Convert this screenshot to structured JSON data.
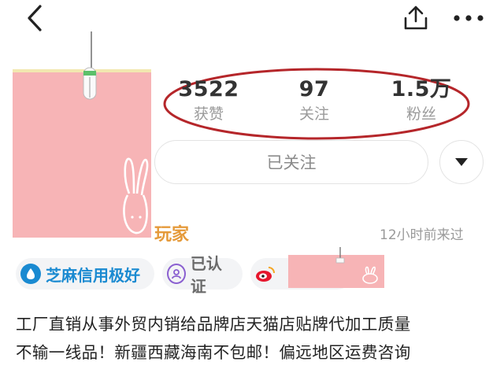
{
  "header": {
    "back_icon": "chevron-left-icon",
    "share_icon": "share-icon",
    "more_icon": "more-horizontal-icon"
  },
  "stats": [
    {
      "value": "3522",
      "label": "获赞"
    },
    {
      "value": "97",
      "label": "关注"
    },
    {
      "value": "1.5万",
      "label": "粉丝"
    }
  ],
  "follow": {
    "label": "已关注",
    "dropdown_icon": "caret-down-icon"
  },
  "profile": {
    "name_fragment": "玩家",
    "last_seen": "12小时前来过"
  },
  "tags": [
    {
      "label": "芝麻信用极好",
      "icon": "sesame-credit-icon",
      "color": "#1a8ad1"
    },
    {
      "label": "已认证",
      "icon": "verified-user-icon",
      "color": "#6a6a6a"
    },
    {
      "label": "",
      "icon": "weibo-icon",
      "color": "#e6162d"
    }
  ],
  "bio": [
    "工厂直销从事外贸内销给品牌店天猫店贴牌代加工质量",
    "不输一线品！新疆西藏海南不包邮！偏远地区运费咨询"
  ],
  "colors": {
    "highlight_oval": "#b5262a",
    "avatar_placeholder": "#f7b4b6",
    "name_orange": "#e59a3a"
  }
}
